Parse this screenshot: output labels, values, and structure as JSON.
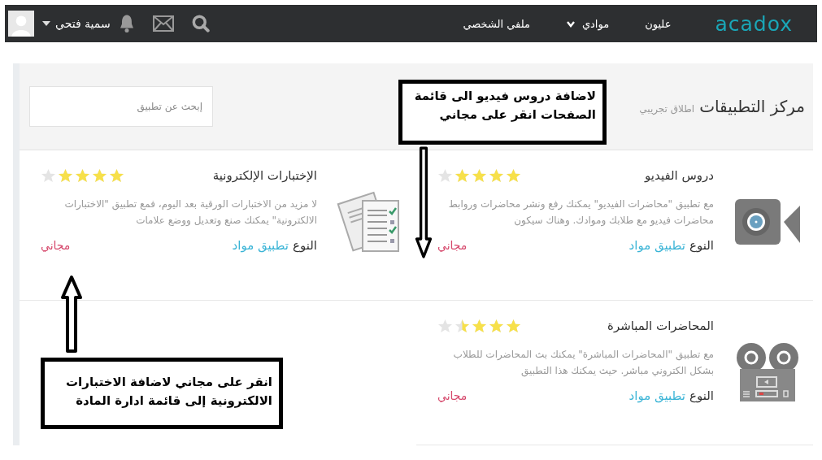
{
  "nav": {
    "logo": "acadox",
    "links": [
      {
        "label": "عليون",
        "kind": "link"
      },
      {
        "label": "موادي",
        "kind": "dropdown"
      },
      {
        "label": "ملفي الشخصي",
        "kind": "link"
      }
    ],
    "user": {
      "name": "سمية فتحي"
    }
  },
  "header": {
    "title": "مركز التطبيقات",
    "subtitle": "اطلاق تجريبي",
    "search": {
      "placeholder": "إبحث عن تطبيق"
    }
  },
  "apps": [
    {
      "name": "دروس الفيديو",
      "stars": 4,
      "description": "مع تطبيق \"محاضرات الفيديو\" يمكنك رفع ونشر محاضرات وروابط محاضرات فيديو مع طلابك وموادك. وهناك سيكون",
      "type_label": "النوع",
      "type": "تطبيق مواد",
      "price": "مجاني"
    },
    {
      "name": "الإختبارات الإلكترونية",
      "stars": 4,
      "description": "لا مزيد من الاختبارات الورقية بعد اليوم، فمع تطبيق \"الاختبارات الالكترونية\" يمكنك صنع وتعديل ووضع علامات",
      "type_label": "النوع",
      "type": "تطبيق مواد",
      "price": "مجاني"
    },
    {
      "name": "المحاضرات المباشرة",
      "stars": 3.5,
      "description": "مع تطبيق \"المحاضرات المباشرة\" يمكنك بث المحاضرات للطلاب بشكل الكتروني مباشر. حيث يمكنك هذا التطبيق",
      "type_label": "النوع",
      "type": "تطبيق مواد",
      "price": "مجاني"
    }
  ],
  "callouts": [
    {
      "text": "لاضافة دروس فيديو الى قائمة الصفحات انقر على مجاني"
    },
    {
      "text": "انقر على مجاني لاضافة الاختبارات الالكترونية إلى قائمة ادارة المادة"
    }
  ]
}
